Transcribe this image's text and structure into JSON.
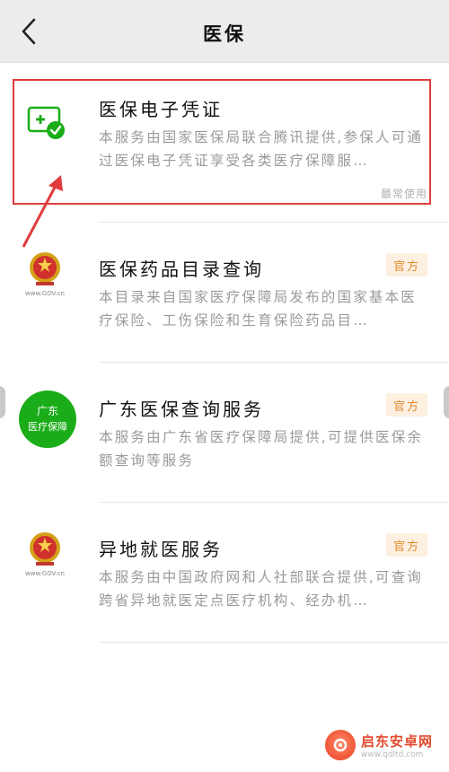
{
  "header": {
    "title": "医保",
    "back_icon": "chevron-left-icon"
  },
  "items": [
    {
      "title": "医保电子凭证",
      "desc": "本服务由国家医保局联合腾讯提供,参保人可通过医保电子凭证享受各类医疗保障服…",
      "tag": "最常使用",
      "icon": "e-voucher-icon"
    },
    {
      "title": "医保药品目录查询",
      "desc": "本目录来自国家医疗保障局发布的国家基本医疗保险、工伤保险和生育保险药品目…",
      "badge": "官方",
      "icon": "national-emblem-icon",
      "icon_caption": "www.GOV.cn"
    },
    {
      "title": "广东医保查询服务",
      "desc": "本服务由广东省医疗保障局提供,可提供医保余额查询等服务",
      "badge": "官方",
      "icon": "guangdong-medical-icon",
      "icon_text": [
        "广东",
        "医疗保障"
      ]
    },
    {
      "title": "异地就医服务",
      "desc": "本服务由中国政府网和人社部联合提供,可查询跨省异地就医定点医疗机构、经办机…",
      "badge": "官方",
      "icon": "national-emblem-icon",
      "icon_caption": "www.GOV.cn"
    }
  ],
  "watermark": {
    "name": "启东安卓网",
    "url": "www.qdltd.com"
  },
  "colors": {
    "accent_red": "#e03c3c",
    "official_orange": "#e08a2e",
    "green": "#1aad19"
  }
}
